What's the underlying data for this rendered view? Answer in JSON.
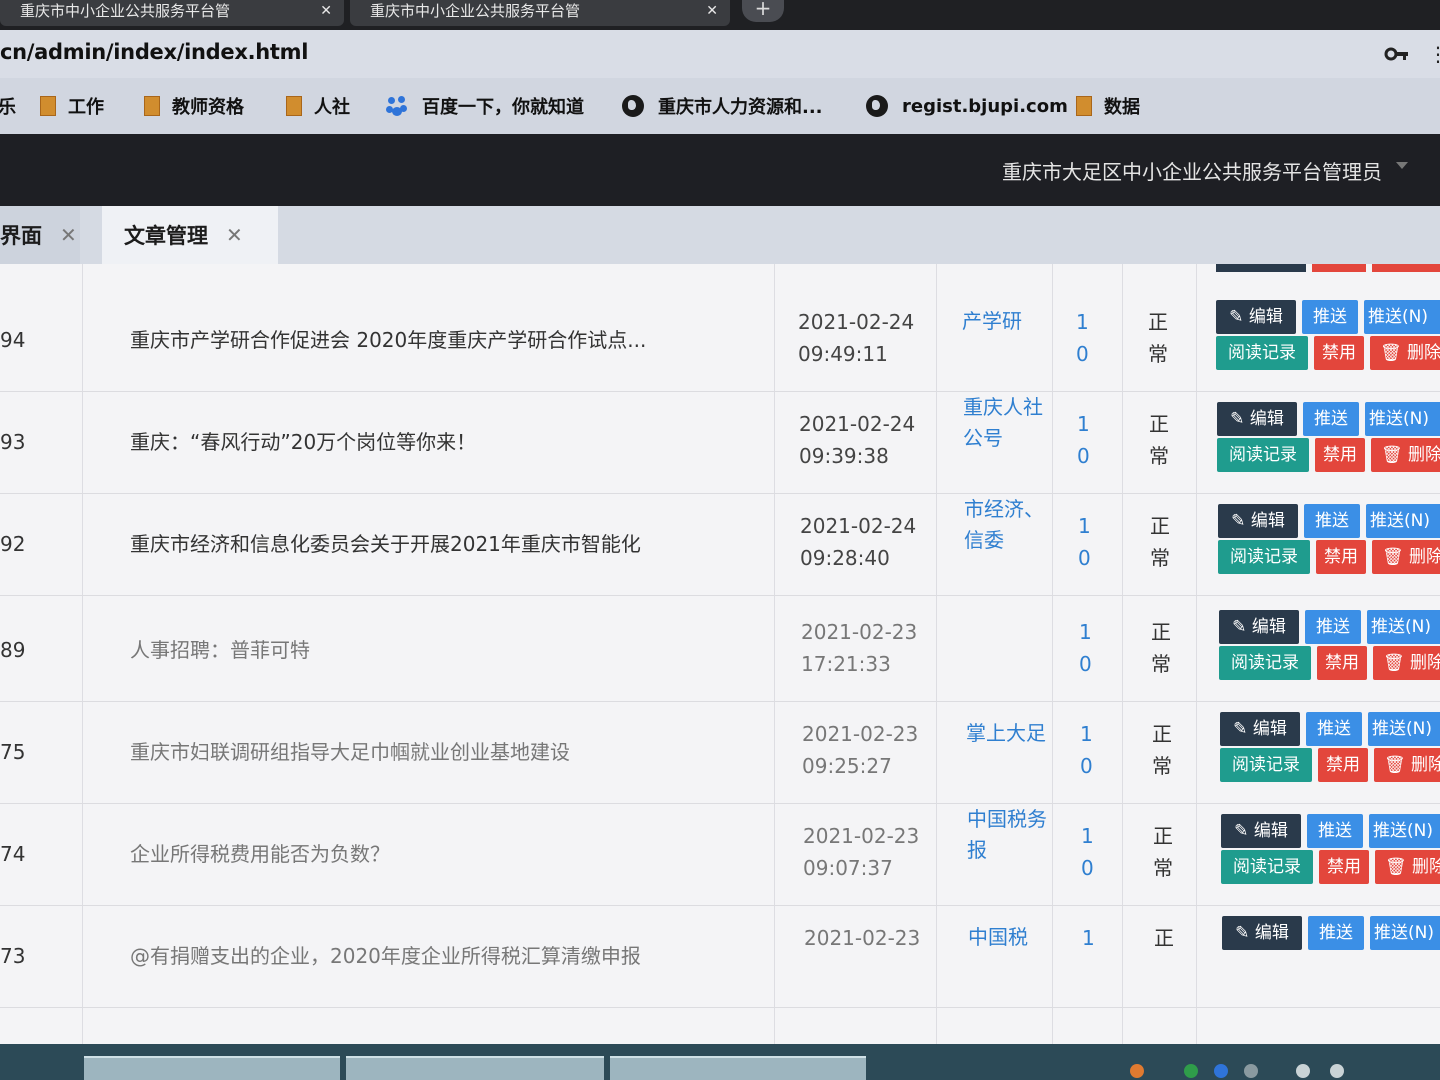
{
  "browser": {
    "tabs": [
      {
        "title": "重庆市中小企业公共服务平台管"
      },
      {
        "title": "重庆市中小企业公共服务平台管"
      }
    ],
    "url": "cn/admin/index/index.html"
  },
  "bookmarks": [
    {
      "label": "乐",
      "icon": "folder-icon"
    },
    {
      "label": "工作",
      "icon": "folder-icon"
    },
    {
      "label": "教师资格",
      "icon": "folder-icon"
    },
    {
      "label": "人社",
      "icon": "folder-icon"
    },
    {
      "label": "百度一下，你就知道",
      "icon": "baidu-paw-icon"
    },
    {
      "label": "重庆市人力资源和...",
      "icon": "globe-icon"
    },
    {
      "label": "regist.bjupi.com",
      "icon": "globe-icon"
    },
    {
      "label": "数据",
      "icon": "folder-icon"
    }
  ],
  "header": {
    "user": "重庆市大足区中小企业公共服务平台管理员"
  },
  "page_tabs": [
    {
      "label": "界面"
    },
    {
      "label": "文章管理"
    }
  ],
  "buttons": {
    "edit": "编辑",
    "push": "推送",
    "push_n": "推送(N)",
    "read_log": "阅读记录",
    "disable": "禁用",
    "delete": "删除"
  },
  "rows": [
    {
      "id": "94",
      "title": "重庆市产学研合作促进会 2020年度重庆产学研合作试点...",
      "time": "2021-02-24 09:49:11",
      "source": "产学研",
      "n1": "1",
      "n2": "0",
      "status": "正常"
    },
    {
      "id": "93",
      "title": "重庆：“春风行动”20万个岗位等你来！",
      "time": "2021-02-24 09:39:38",
      "source": "重庆人社公号",
      "n1": "1",
      "n2": "0",
      "status": "正常"
    },
    {
      "id": "92",
      "title": "重庆市经济和信息化委员会关于开展2021年重庆市智能化",
      "time": "2021-02-24 09:28:40",
      "source": "市经济、信委",
      "n1": "1",
      "n2": "0",
      "status": "正常"
    },
    {
      "id": "89",
      "title": "人事招聘：普菲可特",
      "time": "2021-02-23 17:21:33",
      "source": "",
      "n1": "1",
      "n2": "0",
      "status": "正常"
    },
    {
      "id": "75",
      "title": "重庆市妇联调研组指导大足巾帼就业创业基地建设",
      "time": "2021-02-23 09:25:27",
      "source": "掌上大足",
      "n1": "1",
      "n2": "0",
      "status": "正常"
    },
    {
      "id": "74",
      "title": "企业所得税费用能否为负数？",
      "time": "2021-02-23 09:07:37",
      "source": "中国税务报",
      "n1": "1",
      "n2": "0",
      "status": "正常"
    },
    {
      "id": "73",
      "title": "@有捐赠支出的企业，2020年度企业所得税汇算清缴申报",
      "time": "2021-02-23",
      "source": "中国税",
      "n1": "1",
      "n2": "",
      "status": "正"
    }
  ],
  "colors": {
    "edit_btn": "#2a3a4b",
    "push_btn": "#3b8fe6",
    "read_btn": "#1f9c8e",
    "danger_btn": "#e3463c",
    "link": "#2f7fd0",
    "header_bg": "#1e1f24"
  }
}
